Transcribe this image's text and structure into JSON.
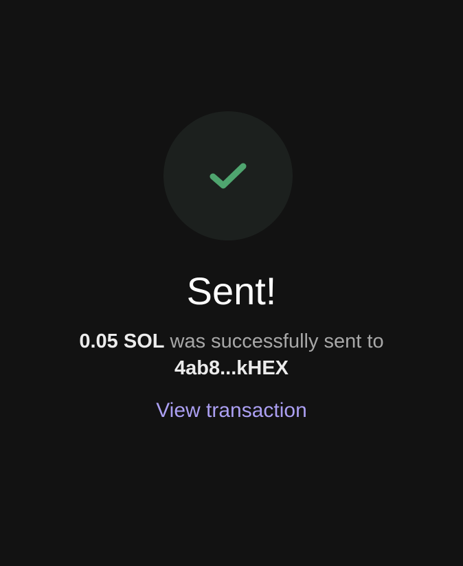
{
  "status": {
    "icon": "checkmark-icon",
    "title": "Sent!"
  },
  "message": {
    "amount": "0.05 SOL",
    "text": " was successfully sent to ",
    "recipient": "4ab8...kHEX"
  },
  "actions": {
    "view_transaction_label": "View transaction"
  },
  "colors": {
    "background": "#121212",
    "circle": "#1c201e",
    "check": "#4fa56f",
    "link": "#ab9ff2"
  }
}
